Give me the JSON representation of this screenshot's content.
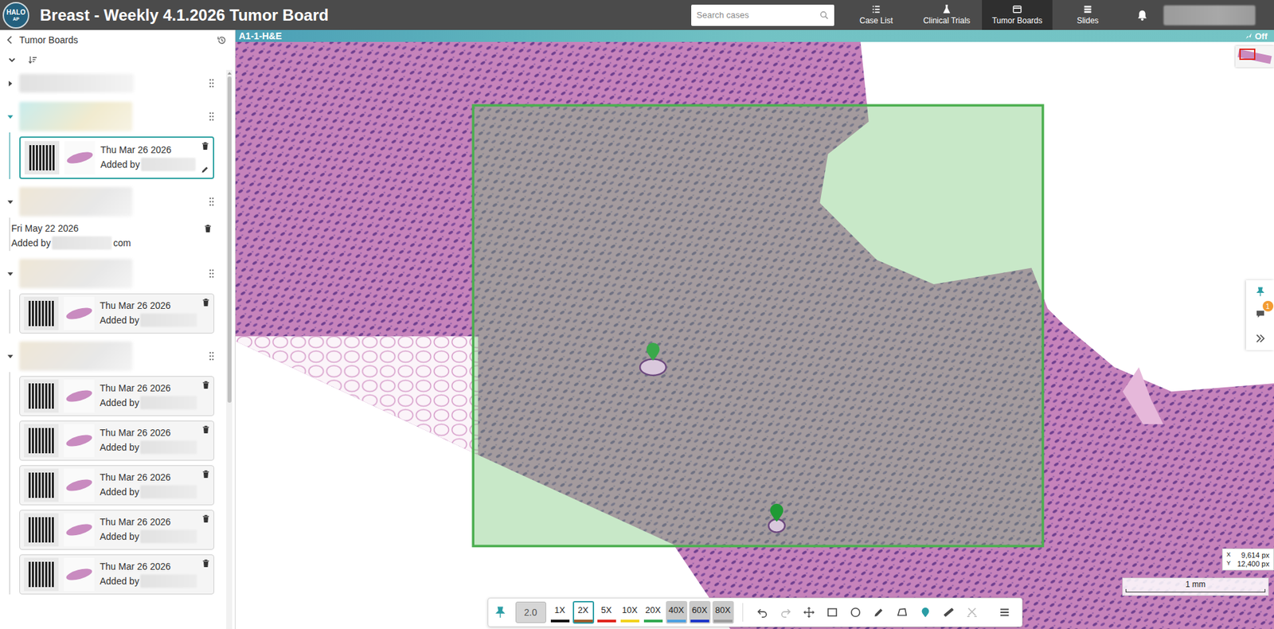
{
  "header": {
    "logo": {
      "text": "HALO",
      "sub": "AP"
    },
    "title": "Breast - Weekly 4.1.2026 Tumor Board",
    "search": {
      "placeholder": "Search cases"
    },
    "nav": [
      {
        "label": "Case List",
        "kind": "list",
        "selected": false
      },
      {
        "label": "Clinical Trials",
        "kind": "flask",
        "selected": false
      },
      {
        "label": "Tumor Boards",
        "kind": "board",
        "selected": true
      },
      {
        "label": "Slides",
        "kind": "slides",
        "selected": false
      }
    ]
  },
  "sidebar": {
    "back_label": "Tumor Boards",
    "groups": [
      {
        "expanded": false,
        "selected": false,
        "items": []
      },
      {
        "expanded": true,
        "selected": true,
        "items": [
          {
            "kind": "card",
            "date": "Thu Mar 26 2026",
            "added_by": "Added by",
            "selected": true
          }
        ]
      },
      {
        "expanded": true,
        "selected": false,
        "items": [
          {
            "kind": "plain",
            "date": "Fri May 22 2026",
            "added_by": "Added by",
            "suffix": "com",
            "selected": false
          }
        ]
      },
      {
        "expanded": true,
        "selected": false,
        "items": [
          {
            "kind": "card",
            "date": "Thu Mar 26 2026",
            "added_by": "Added by",
            "selected": false
          }
        ]
      },
      {
        "expanded": true,
        "selected": false,
        "items": [
          {
            "kind": "card",
            "date": "Thu Mar 26 2026",
            "added_by": "Added by",
            "selected": false
          },
          {
            "kind": "card",
            "date": "Thu Mar 26 2026",
            "added_by": "Added by",
            "selected": false
          },
          {
            "kind": "card",
            "date": "Thu Mar 26 2026",
            "added_by": "Added by",
            "selected": false
          },
          {
            "kind": "card",
            "date": "Thu Mar 26 2026",
            "added_by": "Added by",
            "selected": false
          },
          {
            "kind": "card",
            "date": "Thu Mar 26 2026",
            "added_by": "Added by",
            "selected": false
          }
        ]
      }
    ]
  },
  "viewer": {
    "slide_label": "A1-1-H&E",
    "live_status": "Off",
    "coordinates": {
      "x_label": "X",
      "x": "9,614 px",
      "y_label": "Y",
      "y": "12,400 px"
    },
    "scale_bar": "1 mm",
    "comment_count": "1",
    "toolbar": {
      "magnification": "2.0",
      "zoom_levels": [
        {
          "label": "1X",
          "color": "#111111",
          "selected": false,
          "disabled": false
        },
        {
          "label": "2X",
          "color": "#9a5a2a",
          "selected": true,
          "disabled": false
        },
        {
          "label": "5X",
          "color": "#e0241b",
          "selected": false,
          "disabled": false
        },
        {
          "label": "10X",
          "color": "#f2d21b",
          "selected": false,
          "disabled": false
        },
        {
          "label": "20X",
          "color": "#2fa84f",
          "selected": false,
          "disabled": false
        },
        {
          "label": "40X",
          "color": "#4a9fe0",
          "selected": false,
          "disabled": true
        },
        {
          "label": "60X",
          "color": "#1c35c9",
          "selected": false,
          "disabled": true
        },
        {
          "label": "80X",
          "color": "#9a9a9a",
          "selected": false,
          "disabled": true
        }
      ],
      "tools": [
        {
          "kind": "undo",
          "selected": false,
          "disabled": false
        },
        {
          "kind": "redo",
          "selected": false,
          "disabled": true
        },
        {
          "kind": "move",
          "selected": false,
          "disabled": false
        },
        {
          "kind": "rectangle",
          "selected": false,
          "disabled": false
        },
        {
          "kind": "circle",
          "selected": false,
          "disabled": false
        },
        {
          "kind": "pencil",
          "selected": false,
          "disabled": false
        },
        {
          "kind": "polygon",
          "selected": false,
          "disabled": false
        },
        {
          "kind": "pin",
          "selected": true,
          "disabled": false
        },
        {
          "kind": "ruler",
          "selected": false,
          "disabled": false
        },
        {
          "kind": "cut",
          "selected": false,
          "disabled": true
        },
        {
          "kind": "menu",
          "selected": false,
          "disabled": false
        }
      ]
    }
  }
}
